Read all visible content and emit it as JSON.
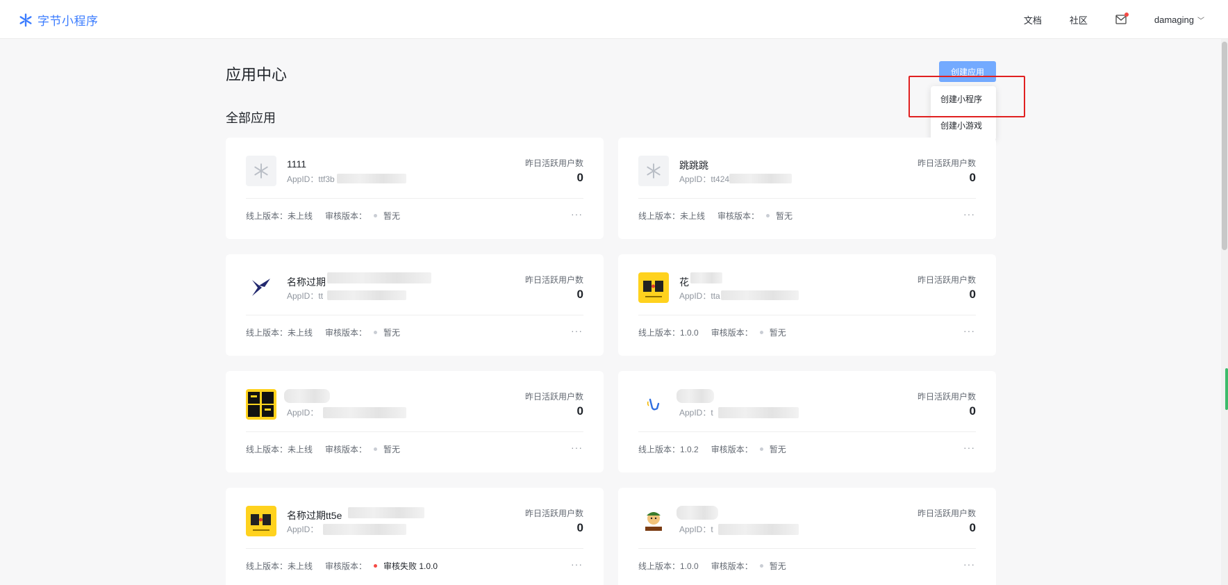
{
  "brand": {
    "name": "字节小程序"
  },
  "nav": {
    "docs": "文档",
    "community": "社区",
    "user": "damaging"
  },
  "page": {
    "title": "应用中心",
    "section": "全部应用"
  },
  "create": {
    "button": "创建应用",
    "menu": [
      "创建小程序",
      "创建小游戏"
    ]
  },
  "labels": {
    "dau": "昨日活跃用户数",
    "appid": "AppID：",
    "online": "线上版本：",
    "review": "审核版本：",
    "more": "···"
  },
  "apps": [
    {
      "name": "1111",
      "appid_prefix": "ttf3b",
      "dau": "0",
      "online": "未上线",
      "review": "暂无",
      "icon": "placeholder-logo"
    },
    {
      "name": "跳跳跳",
      "appid_prefix": "tt424",
      "dau": "0",
      "online": "未上线",
      "review": "暂无",
      "icon": "placeholder-logo"
    },
    {
      "name": "名称过期",
      "appid_prefix": "tt",
      "dau": "0",
      "online": "未上线",
      "review": "暂无",
      "icon": "bird-logo"
    },
    {
      "name": "花",
      "appid_prefix": "tta",
      "dau": "0",
      "online": "1.0.0",
      "review": "暂无",
      "icon": "shihuo-logo"
    },
    {
      "name": "",
      "appid_prefix": "",
      "dau": "0",
      "online": "未上线",
      "review": "暂无",
      "icon": "chihe-logo"
    },
    {
      "name": "",
      "appid_prefix": "t",
      "dau": "0",
      "online": "1.0.2",
      "review": "暂无",
      "icon": "hand-wave-logo"
    },
    {
      "name": "名称过期tt5e",
      "appid_prefix": "",
      "dau": "0",
      "online": "未上线",
      "review": "审核失败 1.0.0",
      "review_status": "fail",
      "icon": "shihuo-logo"
    },
    {
      "name": "",
      "appid_prefix": "t",
      "dau": "0",
      "online": "1.0.0",
      "review": "暂无",
      "icon": "cartoon-logo"
    }
  ],
  "colors": {
    "accent": "#3b7cff",
    "button": "#73aaff",
    "fail": "#f54a45",
    "highlight": "#e02020"
  }
}
